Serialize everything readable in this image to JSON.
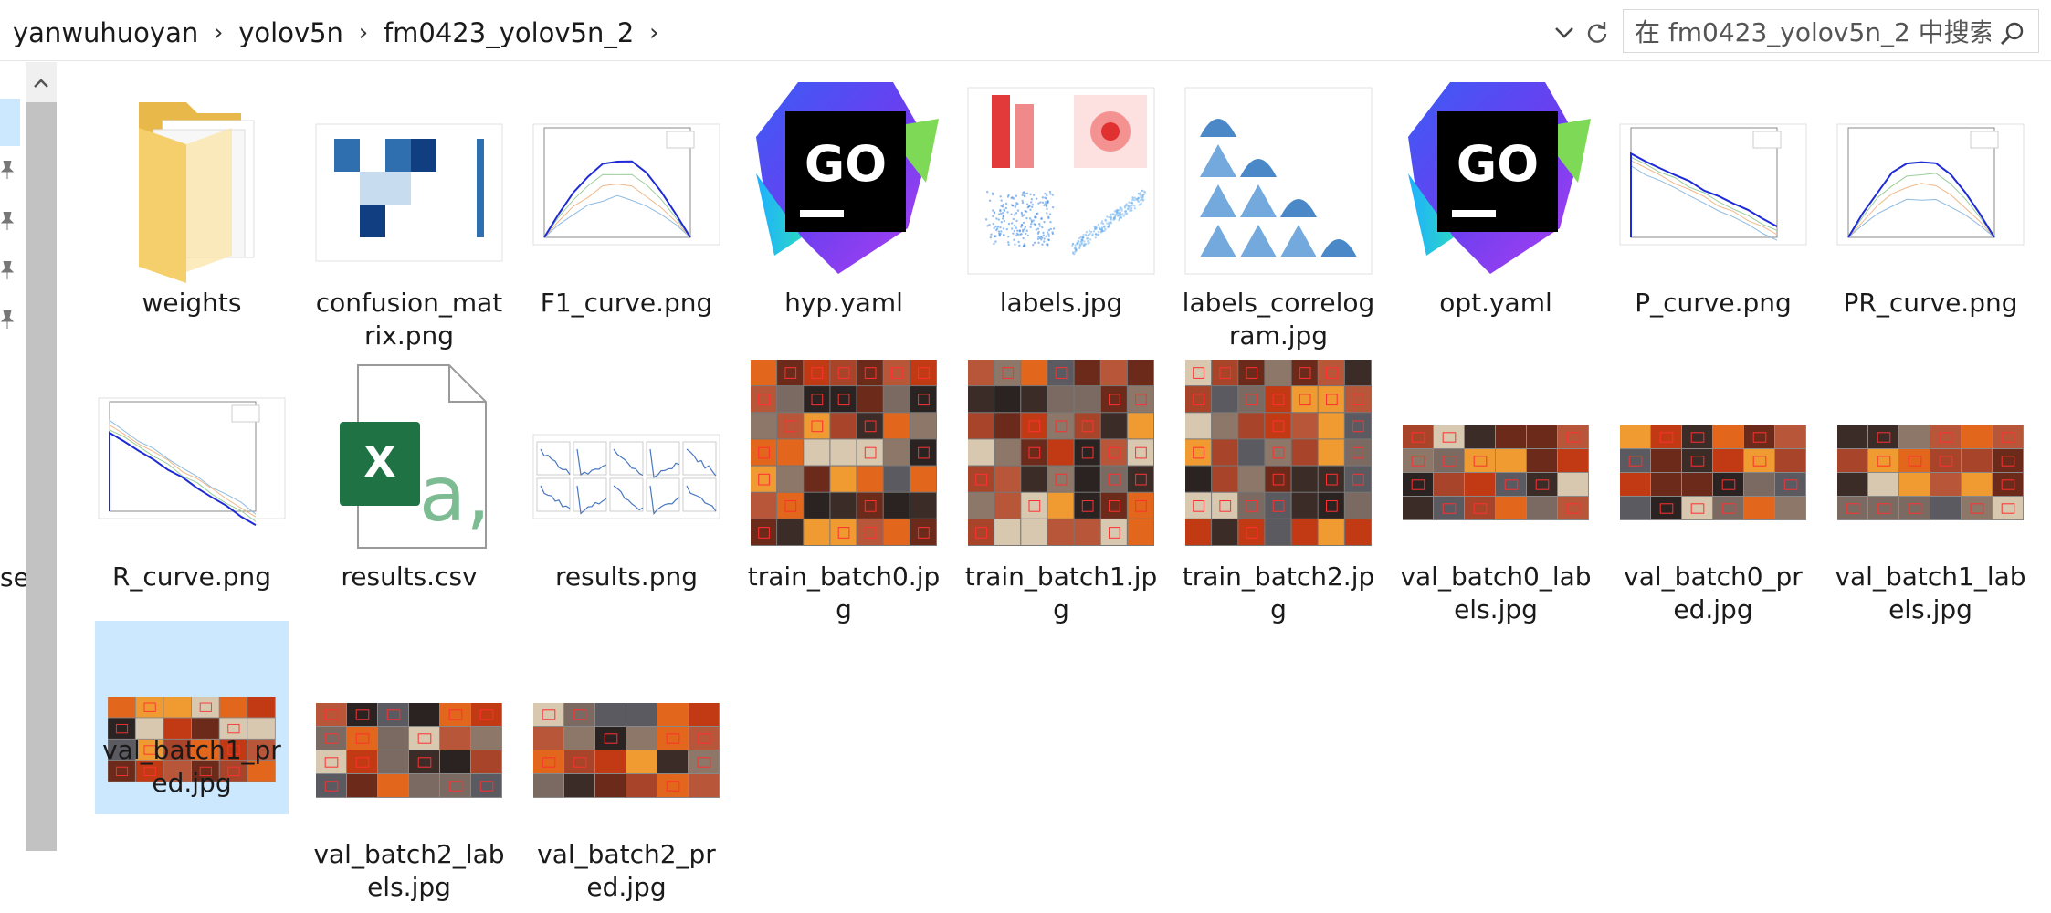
{
  "address_bar": {
    "breadcrumbs": [
      "yanwuhuoyan",
      "yolov5n",
      "fm0423_yolov5n_2"
    ],
    "separator": "›",
    "search_placeholder": "在 fm0423_yolov5n_2 中搜索"
  },
  "left_pane": {
    "clipped_text": "se"
  },
  "files": [
    {
      "name": "weights",
      "kind": "folder"
    },
    {
      "name": "confusion_matrix.png",
      "kind": "confusion"
    },
    {
      "name": "F1_curve.png",
      "kind": "curve"
    },
    {
      "name": "hyp.yaml",
      "kind": "goland"
    },
    {
      "name": "labels.jpg",
      "kind": "labels"
    },
    {
      "name": "labels_correlogram.jpg",
      "kind": "correlogram"
    },
    {
      "name": "opt.yaml",
      "kind": "goland"
    },
    {
      "name": "P_curve.png",
      "kind": "curve"
    },
    {
      "name": "PR_curve.png",
      "kind": "curve"
    },
    {
      "name": "R_curve.png",
      "kind": "curve"
    },
    {
      "name": "results.csv",
      "kind": "excel"
    },
    {
      "name": "results.png",
      "kind": "results"
    },
    {
      "name": "train_batch0.jpg",
      "kind": "train"
    },
    {
      "name": "train_batch1.jpg",
      "kind": "train"
    },
    {
      "name": "train_batch2.jpg",
      "kind": "train"
    },
    {
      "name": "val_batch0_labels.jpg",
      "kind": "val"
    },
    {
      "name": "val_batch0_pred.jpg",
      "kind": "val"
    },
    {
      "name": "val_batch1_labels.jpg",
      "kind": "val"
    },
    {
      "name": "val_batch1_pred.jpg",
      "kind": "val",
      "selected": true
    },
    {
      "name": "val_batch2_labels.jpg",
      "kind": "val"
    },
    {
      "name": "val_batch2_pred.jpg",
      "kind": "val"
    }
  ],
  "colors": {
    "selection": "#cce8ff",
    "folder": "#f5cf6b",
    "excel": "#1f7244",
    "goland_bg": "#000000"
  }
}
